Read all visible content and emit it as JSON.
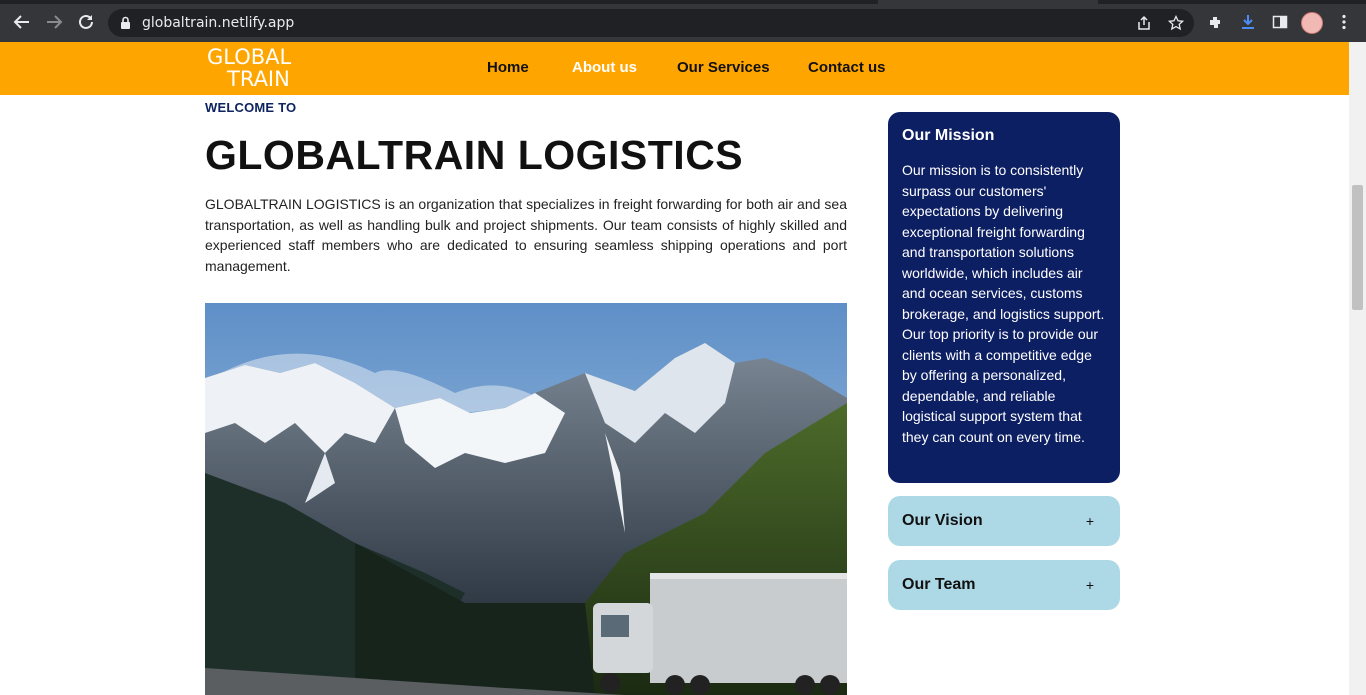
{
  "browser": {
    "url": "globaltrain.netlify.app"
  },
  "site": {
    "logo_line1": "GLOBAL",
    "logo_line2": "TRAIN",
    "nav": [
      {
        "label": "Home"
      },
      {
        "label": "About us"
      },
      {
        "label": "Our Services"
      },
      {
        "label": "Contact us"
      }
    ]
  },
  "main": {
    "welcome": "WELCOME TO",
    "title": "GLOBALTRAIN LOGISTICS",
    "intro": "GLOBALTRAIN LOGISTICS is an organization that specializes in freight forwarding for both air and sea transportation, as well as handling bulk and project shipments. Our team consists of highly skilled and experienced staff members who are dedicated to ensuring seamless shipping operations and port management."
  },
  "sidebar": {
    "mission_title": "Our Mission",
    "mission_text": "Our mission is to consistently surpass our customers' expectations by delivering exceptional freight forwarding and transportation solutions worldwide, which includes air and ocean services, customs brokerage, and logistics support. Our top priority is to provide our clients with a competitive edge by offering a personalized, dependable, and reliable logistical support system that they can count on every time.",
    "accordions": [
      {
        "title": "Our Vision",
        "toggle": "+"
      },
      {
        "title": "Our Team",
        "toggle": "+"
      }
    ]
  },
  "colors": {
    "header_bg": "#ffa500",
    "mission_bg": "#0d1f63",
    "accordion_bg": "#add8e6"
  }
}
